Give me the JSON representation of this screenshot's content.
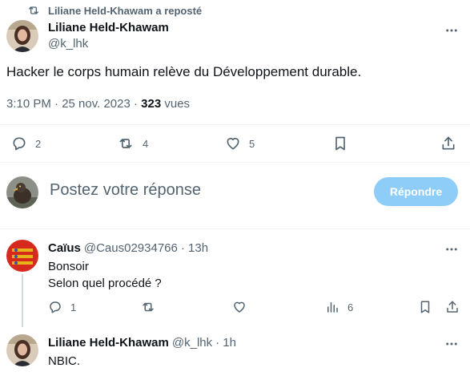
{
  "repost": {
    "label": "Liliane Held-Khawam a reposté",
    "icon": "repost-icon"
  },
  "main_tweet": {
    "author_name": "Liliane Held-Khawam",
    "author_handle": "@k_lhk",
    "text": "Hacker le corps humain relève du Développement durable.",
    "time": "3:10 PM · 25 nov. 2023 · ",
    "views_count": "323",
    "views_label": " vues",
    "replies": "2",
    "reposts": "4",
    "likes": "5"
  },
  "reply_composer": {
    "placeholder": "Postez votre réponse",
    "button_label": "Répondre"
  },
  "replies": [
    {
      "author_name": "Caïus",
      "author_handle": "@Caus02934766",
      "time": "· 13h",
      "lines": [
        "Bonsoir",
        "Selon quel procédé ?"
      ],
      "replies": "1",
      "views": "6"
    },
    {
      "author_name": "Liliane Held-Khawam",
      "author_handle": "@k_lhk",
      "time": "· 1h",
      "lines": [
        "NBIC."
      ]
    }
  ],
  "colors": {
    "accent_disabled": "#8ecdf8",
    "muted": "#536471",
    "divider": "#eff3f4"
  }
}
